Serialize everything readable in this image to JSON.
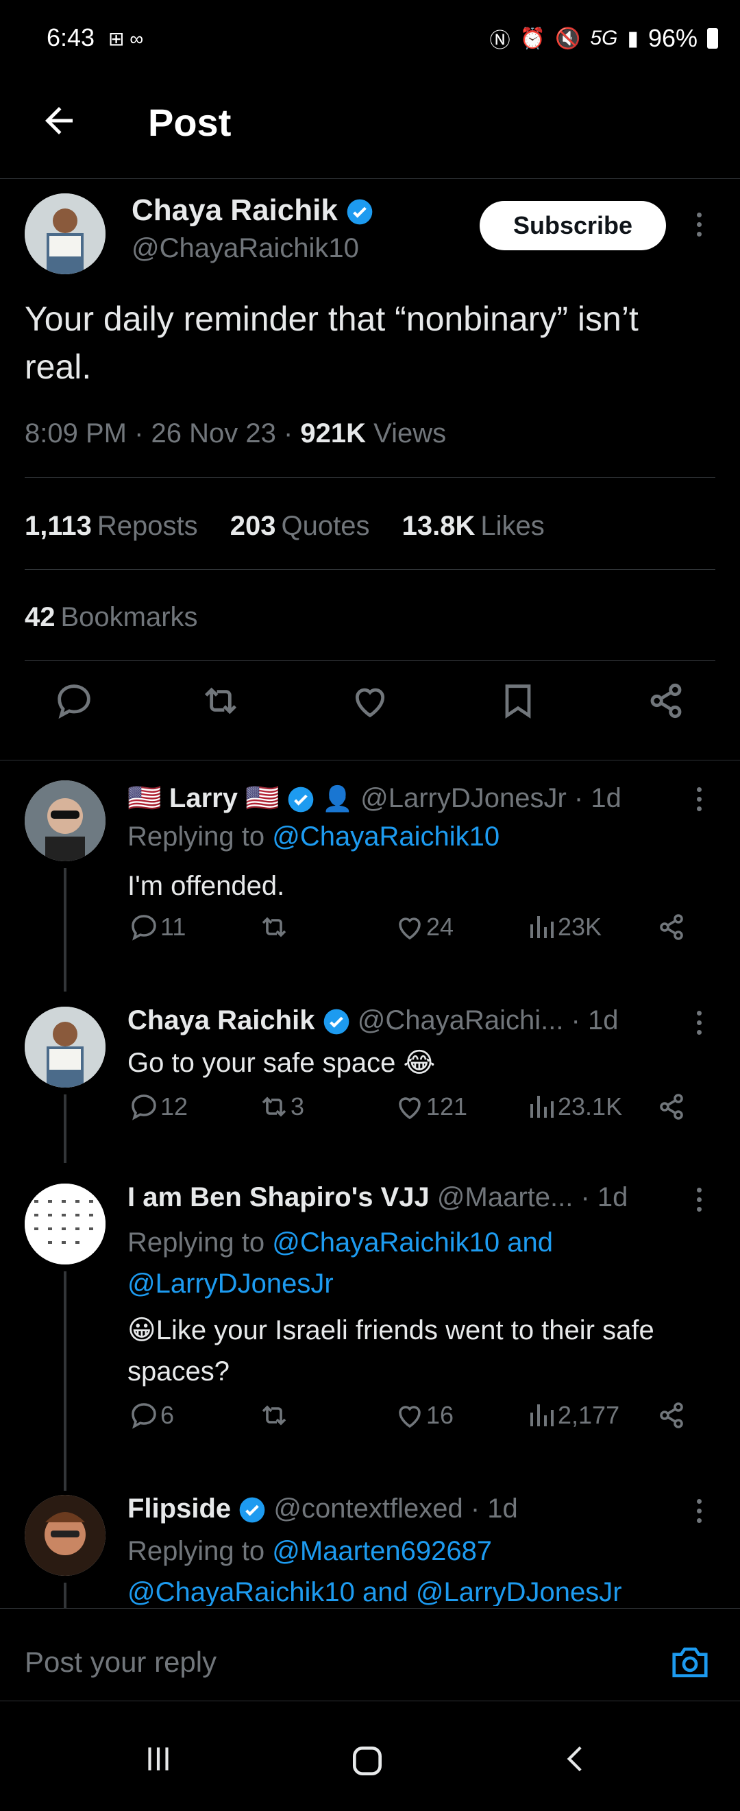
{
  "status": {
    "time": "6:43",
    "network": "5G",
    "battery": "96%"
  },
  "header": {
    "title": "Post"
  },
  "post": {
    "author_name": "Chaya Raichik",
    "handle": "@ChayaRaichik10",
    "subscribe_label": "Subscribe",
    "text": "Your daily reminder that “nonbinary” isn’t real.",
    "time": "8:09 PM · 26 Nov 23 · ",
    "views_count": "921K",
    "views_label": " Views",
    "reposts_count": "1,113",
    "reposts_label": "Reposts",
    "quotes_count": "203",
    "quotes_label": "Quotes",
    "likes_count": "13.8K",
    "likes_label": "Likes",
    "bookmarks_count": "42",
    "bookmarks_label": "Bookmarks"
  },
  "replies": [
    {
      "name": "🇺🇸 Larry 🇺🇸",
      "handle": "@LarryDJonesJr · 1d",
      "replying_prefix": "Replying to ",
      "replying_to": "@ChayaRaichik10",
      "text": "I'm offended.",
      "replies": "11",
      "reposts": "",
      "likes": "24",
      "views": "23K"
    },
    {
      "name": "Chaya Raichik",
      "handle": "@ChayaRaichi... · 1d",
      "text": "Go to your safe space 😂",
      "replies": "12",
      "reposts": "3",
      "likes": "121",
      "views": "23.1K"
    },
    {
      "name": "I am Ben Shapiro's VJJ",
      "handle": "@Maarte... · 1d",
      "replying_prefix": "Replying to ",
      "replying_to": "@ChayaRaichik10 and @LarryDJonesJr",
      "text": "😀Like your Israeli friends went to their safe spaces?",
      "replies": "6",
      "reposts": "",
      "likes": "16",
      "views": "2,177"
    },
    {
      "name": "Flipside",
      "handle": "@contextflexed · 1d",
      "replying_prefix": "Replying to ",
      "replying_to": "@Maarten692687 @ChayaRaichik10 and @LarryDJonesJr"
    }
  ],
  "composer": {
    "placeholder": "Post your reply"
  },
  "colors": {
    "accent": "#1d9bf0",
    "background": "#000000",
    "muted": "#71767b"
  }
}
